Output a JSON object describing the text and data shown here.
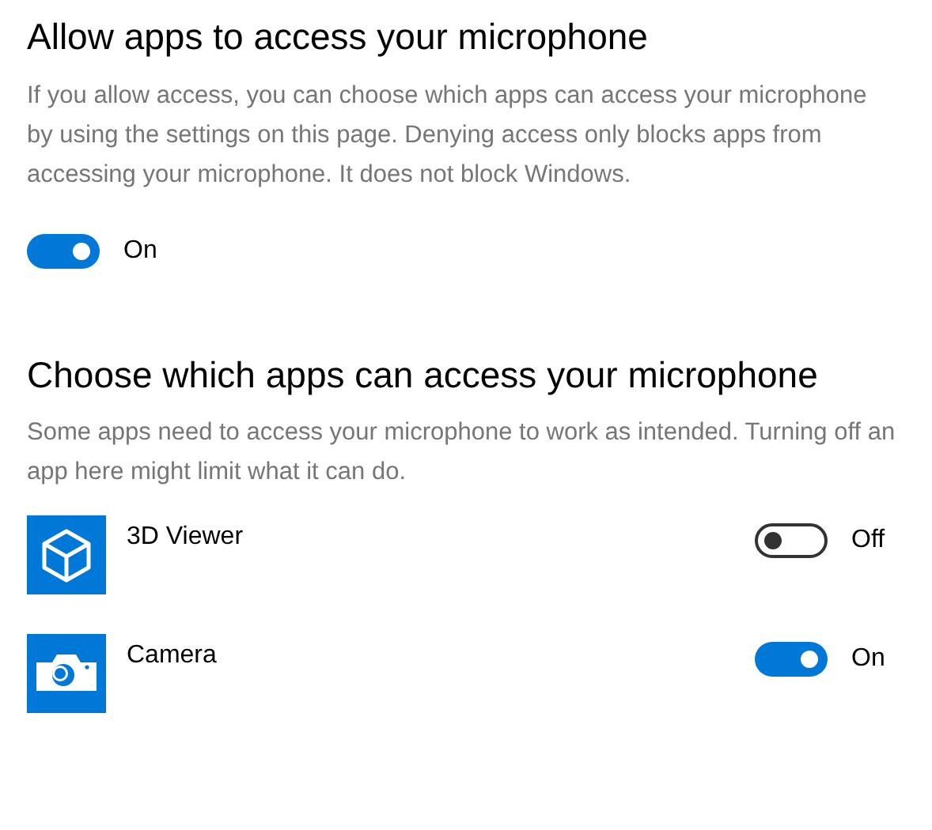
{
  "access_section": {
    "title": "Allow apps to access your microphone",
    "description": "If you allow access, you can choose which apps can access your microphone by using the settings on this page. Denying access only blocks apps from accessing your microphone. It does not block Windows.",
    "toggle": {
      "on": true,
      "label": "On"
    }
  },
  "apps_section": {
    "title": "Choose which apps can access your microphone",
    "description": "Some apps need to access your microphone to work as intended. Turning off an app here might limit what it can do.",
    "apps": [
      {
        "kind": "cube",
        "name": "3D Viewer",
        "on": false,
        "label": "Off"
      },
      {
        "kind": "camera",
        "name": "Camera",
        "on": true,
        "label": "On"
      }
    ]
  }
}
